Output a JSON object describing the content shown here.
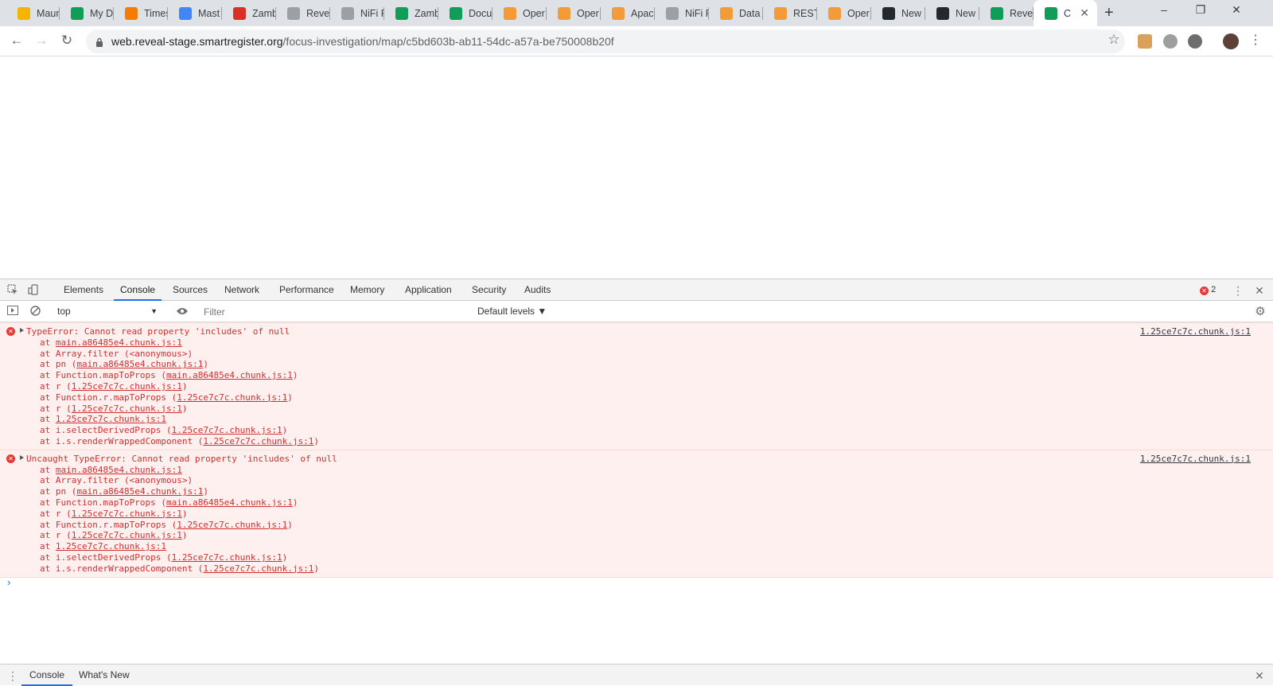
{
  "browser": {
    "tabs": [
      {
        "label": "Maur",
        "icon": "google-drive-icon",
        "color": "#f4b400"
      },
      {
        "label": "My D",
        "icon": "google-drive-icon",
        "color": "#0f9d58"
      },
      {
        "label": "Times",
        "icon": "hubstaff-h-icon",
        "color": "#f57c00"
      },
      {
        "label": "Mast",
        "icon": "google-docs-icon",
        "color": "#4285f4"
      },
      {
        "label": "Zamb",
        "icon": "gmail-icon",
        "color": "#d93025"
      },
      {
        "label": "Revea",
        "icon": "document-icon",
        "color": "#9aa0a6"
      },
      {
        "label": "NiFi F",
        "icon": "nifi-drop-icon",
        "color": "#9aa0a6"
      },
      {
        "label": "Zamb",
        "icon": "google-drive-icon",
        "color": "#0f9d58"
      },
      {
        "label": "Docu",
        "icon": "google-sheets-icon",
        "color": "#0f9d58"
      },
      {
        "label": "Oper",
        "icon": "openmrs-icon",
        "color": "#f29b38"
      },
      {
        "label": "Oper",
        "icon": "openmrs-icon",
        "color": "#f29b38"
      },
      {
        "label": "Apac",
        "icon": "openmrs-icon",
        "color": "#f29b38"
      },
      {
        "label": "NiFi F",
        "icon": "nifi-drop-icon",
        "color": "#9aa0a6"
      },
      {
        "label": "Data",
        "icon": "openmrs-icon",
        "color": "#f29b38"
      },
      {
        "label": "REST",
        "icon": "openmrs-icon",
        "color": "#f29b38"
      },
      {
        "label": "Oper",
        "icon": "openmrs-icon",
        "color": "#f29b38"
      },
      {
        "label": "New",
        "icon": "github-icon",
        "color": "#24292e"
      },
      {
        "label": "New",
        "icon": "github-icon",
        "color": "#24292e"
      },
      {
        "label": "Reve",
        "icon": "google-sheets-icon",
        "color": "#0f9d58"
      },
      {
        "label": "C",
        "icon": "reveal-q-icon",
        "color": "#0f9d58",
        "active": true
      }
    ],
    "url_host": "web.reveal-stage.smartregister.org",
    "url_path": "/focus-investigation/map/c5bd603b-ab11-54dc-a57a-be750008b20f"
  },
  "devtools": {
    "tabs": [
      "Elements",
      "Console",
      "Sources",
      "Network",
      "Performance",
      "Memory",
      "Application",
      "Security",
      "Audits"
    ],
    "active_tab": "Console",
    "error_count": "2",
    "context": "top",
    "filter_placeholder": "Filter",
    "levels": "Default levels ▼",
    "drawer_tabs": [
      "Console",
      "What's New"
    ]
  },
  "console_messages": [
    {
      "text": "TypeError: Cannot read property 'includes' of null",
      "source": "1.25ce7c7c.chunk.js:1",
      "frames": [
        {
          "prefix": "at ",
          "fn": "",
          "link": "main.a86485e4.chunk.js:1"
        },
        {
          "prefix": "at ",
          "fn": "Array.filter (<anonymous>)",
          "link": ""
        },
        {
          "prefix": "at ",
          "fn": "pn (",
          "link": "main.a86485e4.chunk.js:1",
          "suffix": ")"
        },
        {
          "prefix": "at ",
          "fn": "Function.mapToProps (",
          "link": "main.a86485e4.chunk.js:1",
          "suffix": ")"
        },
        {
          "prefix": "at ",
          "fn": "r (",
          "link": "1.25ce7c7c.chunk.js:1",
          "suffix": ")"
        },
        {
          "prefix": "at ",
          "fn": "Function.r.mapToProps (",
          "link": "1.25ce7c7c.chunk.js:1",
          "suffix": ")"
        },
        {
          "prefix": "at ",
          "fn": "r (",
          "link": "1.25ce7c7c.chunk.js:1",
          "suffix": ")"
        },
        {
          "prefix": "at ",
          "fn": "",
          "link": "1.25ce7c7c.chunk.js:1"
        },
        {
          "prefix": "at ",
          "fn": "i.selectDerivedProps (",
          "link": "1.25ce7c7c.chunk.js:1",
          "suffix": ")"
        },
        {
          "prefix": "at ",
          "fn": "i.s.renderWrappedComponent (",
          "link": "1.25ce7c7c.chunk.js:1",
          "suffix": ")"
        }
      ]
    },
    {
      "text": "Uncaught TypeError: Cannot read property 'includes' of null",
      "source": "1.25ce7c7c.chunk.js:1",
      "frames": [
        {
          "prefix": "at ",
          "fn": "",
          "link": "main.a86485e4.chunk.js:1"
        },
        {
          "prefix": "at ",
          "fn": "Array.filter (<anonymous>)",
          "link": ""
        },
        {
          "prefix": "at ",
          "fn": "pn (",
          "link": "main.a86485e4.chunk.js:1",
          "suffix": ")"
        },
        {
          "prefix": "at ",
          "fn": "Function.mapToProps (",
          "link": "main.a86485e4.chunk.js:1",
          "suffix": ")"
        },
        {
          "prefix": "at ",
          "fn": "r (",
          "link": "1.25ce7c7c.chunk.js:1",
          "suffix": ")"
        },
        {
          "prefix": "at ",
          "fn": "Function.r.mapToProps (",
          "link": "1.25ce7c7c.chunk.js:1",
          "suffix": ")"
        },
        {
          "prefix": "at ",
          "fn": "r (",
          "link": "1.25ce7c7c.chunk.js:1",
          "suffix": ")"
        },
        {
          "prefix": "at ",
          "fn": "",
          "link": "1.25ce7c7c.chunk.js:1"
        },
        {
          "prefix": "at ",
          "fn": "i.selectDerivedProps (",
          "link": "1.25ce7c7c.chunk.js:1",
          "suffix": ")"
        },
        {
          "prefix": "at ",
          "fn": "i.s.renderWrappedComponent (",
          "link": "1.25ce7c7c.chunk.js:1",
          "suffix": ")"
        }
      ]
    }
  ]
}
